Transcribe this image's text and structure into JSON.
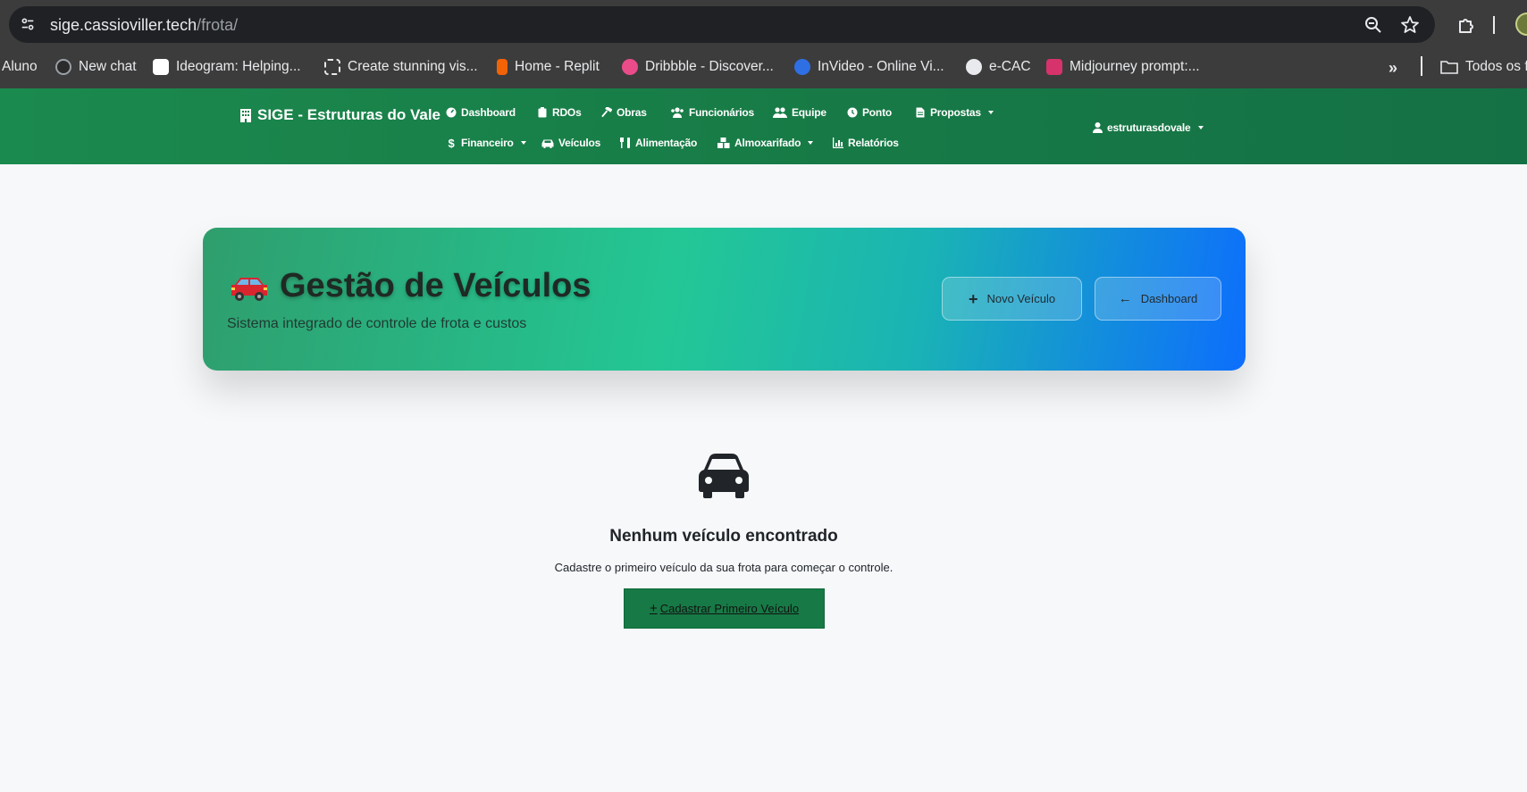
{
  "browser": {
    "url_host": "sige.cassioviller.tech",
    "url_path": "/frota/",
    "bookmarks": [
      {
        "label": "Aluno",
        "color": ""
      },
      {
        "label": "New chat",
        "color": "#2b2b2b"
      },
      {
        "label": "Ideogram: Helping...",
        "color": "#ffffff"
      },
      {
        "label": "Create stunning vis...",
        "color": "#3c3c3c"
      },
      {
        "label": "Home - Replit",
        "color": "#f26207"
      },
      {
        "label": "Dribbble - Discover...",
        "color": "#ea4c89"
      },
      {
        "label": "InVideo - Online Vi...",
        "color": "#2f6fe4"
      },
      {
        "label": "e-CAC",
        "color": "#e8eaed"
      },
      {
        "label": "Midjourney prompt:...",
        "color": "#d6336c"
      }
    ],
    "all_bookmarks_label": "Todos os f"
  },
  "navbar": {
    "brand": "SIGE - Estruturas do Vale",
    "row1": [
      {
        "label": "Dashboard",
        "icon": "gauge-icon",
        "caret": false
      },
      {
        "label": "RDOs",
        "icon": "clipboard-icon",
        "caret": false
      },
      {
        "label": "Obras",
        "icon": "hammer-icon",
        "caret": false
      },
      {
        "label": "Funcionários",
        "icon": "users-icon",
        "caret": false
      },
      {
        "label": "Equipe",
        "icon": "user-group-icon",
        "caret": false
      },
      {
        "label": "Ponto",
        "icon": "clock-icon",
        "caret": false
      },
      {
        "label": "Propostas",
        "icon": "file-icon",
        "caret": true
      }
    ],
    "row2": [
      {
        "label": "Financeiro",
        "icon": "dollar-icon",
        "caret": true
      },
      {
        "label": "Veículos",
        "icon": "car-icon",
        "caret": false
      },
      {
        "label": "Alimentação",
        "icon": "utensils-icon",
        "caret": false
      },
      {
        "label": "Almoxarifado",
        "icon": "boxes-icon",
        "caret": true
      },
      {
        "label": "Relatórios",
        "icon": "chart-icon",
        "caret": false
      }
    ],
    "user": "estruturasdovale"
  },
  "hero": {
    "title": "Gestão de Veículos",
    "subtitle": "Sistema integrado de controle de frota e custos",
    "new_button": "Novo Veículo",
    "back_button": "Dashboard"
  },
  "empty_state": {
    "title": "Nenhum veículo encontrado",
    "text": "Cadastre o primeiro veículo da sua frota para começar o controle.",
    "cta": "Cadastrar Primeiro Veículo"
  },
  "colors": {
    "navbar": "#177a46",
    "chrome": "#3c3c3c",
    "urlbar": "#202124",
    "cta": "#177a46"
  }
}
